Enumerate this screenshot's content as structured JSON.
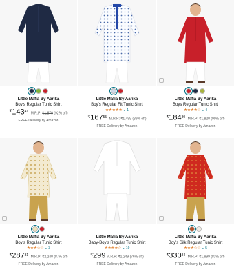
{
  "products": [
    {
      "brand": "Little Mafia By Aarika",
      "title": "Boy's Regular Tunic Shirt",
      "rating_stars": "",
      "rating_count": "",
      "currency": "₹",
      "price_whole": "143",
      "price_fraction": "41",
      "mrp_label": "M.R.P:",
      "mrp": "₹1,870",
      "discount": "(92% off)",
      "delivery": "FREE Delivery by Amazon",
      "swatch_colors": [
        "#1f2a44",
        "#7fb238",
        "#c8202a"
      ]
    },
    {
      "brand": "Little Mafia By Aarika",
      "title": "Boy's Regular Fit Tunic Shirt",
      "rating_stars": "★★★★★",
      "rating_count": "1",
      "currency": "₹",
      "price_whole": "167",
      "price_fraction": "55",
      "mrp_label": "M.R.P:",
      "mrp": "₹1,499",
      "discount": "(89% off)",
      "delivery": "FREE Delivery by Amazon",
      "swatch_colors": [
        "#cfd8e8",
        "#c8202a"
      ]
    },
    {
      "brand": "Little Mafia By Aarika",
      "title": "Boys Regular Tunic Shirt",
      "rating_stars": "★★★★☆",
      "rating_count": "4",
      "currency": "₹",
      "price_whole": "184",
      "price_fraction": "30",
      "mrp_label": "M.R.P:",
      "mrp": "₹1,820",
      "discount": "(90% off)",
      "delivery": "FREE Delivery by Amazon",
      "swatch_colors": [
        "#c8202a",
        "#1f2a44",
        "#a8b33a"
      ]
    },
    {
      "brand": "Little Mafia By Aarika",
      "title": "Boy's Regular Tunic Shirt",
      "rating_stars": "★★★☆☆",
      "rating_count": "3",
      "currency": "₹",
      "price_whole": "287",
      "price_fraction": "31",
      "mrp_label": "M.R.P:",
      "mrp": "₹2,240",
      "discount": "(87% off)",
      "delivery": "FREE Delivery by Amazon",
      "swatch_colors": [
        "#efe3b8",
        "#c8202a"
      ]
    },
    {
      "brand": "Little Mafia By Aarika",
      "title": "Baby-Boy's Regular Tunic Shirt",
      "rating_stars": "★★★★☆",
      "rating_count": "19",
      "currency": "₹",
      "price_whole": "299",
      "price_fraction": "",
      "mrp_label": "M.R.P:",
      "mrp": "₹1,249",
      "discount": "(76% off)",
      "delivery": "FREE Delivery by Amazon",
      "swatch_colors": []
    },
    {
      "brand": "Little Mafia By Aarika",
      "title": "Boy's Silk Regular Tunic Shirt",
      "rating_stars": "★★★☆☆",
      "rating_count": "5",
      "currency": "₹",
      "price_whole": "330",
      "price_fraction": "84",
      "mrp_label": "M.R.P:",
      "mrp": "₹1,999",
      "discount": "(83% off)",
      "delivery": "FREE Delivery by Amazon",
      "swatch_colors": [
        "#b5532a",
        "#f2ede4"
      ]
    }
  ]
}
